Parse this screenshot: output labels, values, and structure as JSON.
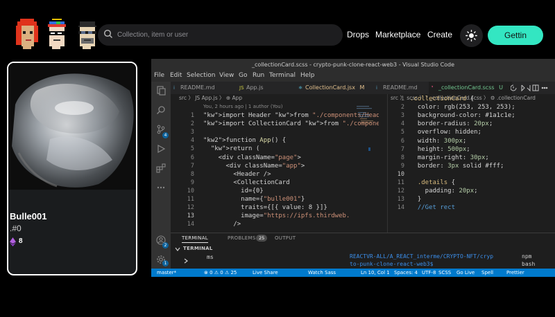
{
  "header": {
    "search_placeholder": "Collection, item or user",
    "nav": {
      "drops": "Drops",
      "marketplace": "Marketplace",
      "create": "Create"
    },
    "cta_label": "Gettin",
    "accent_color": "#33e6c2"
  },
  "card": {
    "name": "Bulle001",
    "id": ".#0",
    "trait_value": "8",
    "trait_icon": "ethereum-icon",
    "border_color": "#ffffff",
    "bg_color": "#1a1c1e"
  },
  "vscode": {
    "title": "_collectionCard.scss - crypto-punk-clone-react-web3 - Visual Studio Code",
    "menu": [
      "File",
      "Edit",
      "Selection",
      "View",
      "Go",
      "Run",
      "Terminal",
      "Help"
    ],
    "tabs": [
      {
        "icon": "i",
        "label": "README.md",
        "suffix": ""
      },
      {
        "icon": "JS",
        "label": "App.js",
        "suffix": ""
      },
      {
        "icon": "⚛",
        "label": "CollectionCard.jsx",
        "suffix": "M"
      },
      {
        "icon": "i",
        "label": "README.md",
        "suffix": ""
      },
      {
        "icon": "❜",
        "label": "_collectionCard.scss",
        "suffix": "U"
      }
    ],
    "left": {
      "breadcrumb": "src  〉 JS App.js 〉 ⊕ App",
      "blame": "You, 2 hours ago | 1 author (You)",
      "line_numbers": [
        "1",
        "2",
        "3",
        "4",
        "5",
        "6",
        "7",
        "8",
        "9",
        "10",
        "11",
        "12",
        "13",
        "14"
      ],
      "lines": [
        "import Header from \"./components/Header",
        "import CollectionCard from \"./component",
        "",
        "function App() {",
        "  return (",
        "    <div className=\"page\">",
        "      <div className=\"app\">",
        "        <Header />",
        "        <CollectionCard",
        "          id={0}",
        "          name={\"bulle001\"}",
        "          traits={[{ value: 8 }]}",
        "          image=\"https://ipfs.thirdweb.",
        "        />"
      ]
    },
    "right": {
      "breadcrumb": "src 〉 scss 〉 ❜ _collectionCard.scss 〉 ⚙ .collectionCard",
      "line_numbers": [
        "1",
        "2",
        "3",
        "4",
        "5",
        "6",
        "7",
        "8",
        "9",
        "10",
        "11",
        "12",
        "13",
        "14"
      ],
      "lines": [
        ".collectionCard {",
        "  color: rgb(253, 253, 253);",
        "  background-color: #1a1c1e;",
        "  border-radius: 20px;",
        "  overflow: hidden;",
        "  width: 300px;",
        "  height: 500px;",
        "  margin-right: 30px;",
        "  border: 3px solid #fff;",
        "",
        "  .details {",
        "    padding: 20px;",
        "  }",
        "  //Get rect"
      ]
    },
    "panel": {
      "tabs": [
        "TERMINAL",
        "PROBLEMS",
        "OUTPUT"
      ],
      "problems_count": "25",
      "section_title": "TERMINAL",
      "prompt_line": "ms",
      "path_line_1": "REACTVR-ALL/A_REACT_interme/CRYPTO-NFT/cryp",
      "path_line_2": "to-punk-clone-react-web3$",
      "terminal_instances": [
        "npm",
        "bash"
      ]
    },
    "status": {
      "branch": "master*",
      "errors": "⊗ 0 ⚠ 0 ⚠ 25",
      "live_share": "Live Share",
      "watch": "Watch Sass",
      "cursor": "Ln 10, Col 1",
      "spaces": "Spaces: 4",
      "encoding": "UTF-8",
      "language": "SCSS",
      "go_live": "Go Live",
      "spell": "Spell",
      "prettier": "Prettier"
    }
  }
}
